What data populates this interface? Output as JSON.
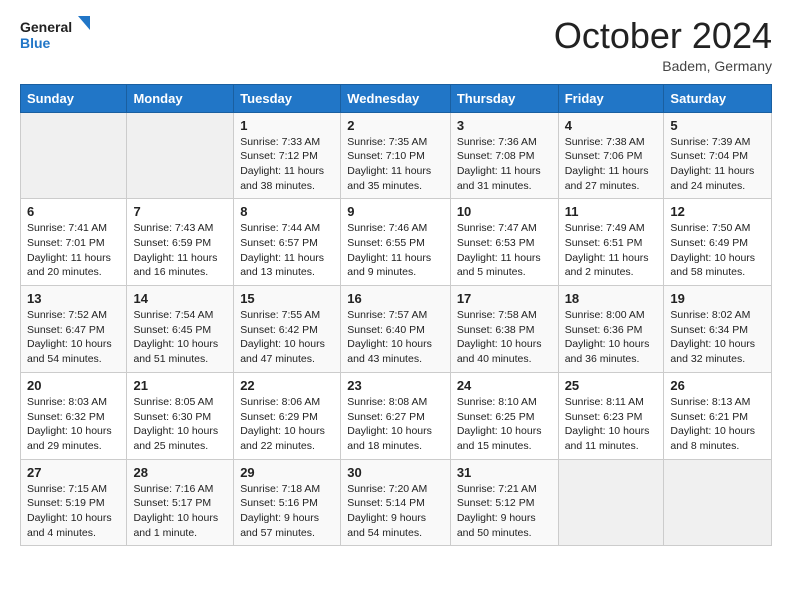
{
  "logo": {
    "line1": "General",
    "line2": "Blue"
  },
  "header": {
    "month": "October 2024",
    "location": "Badem, Germany"
  },
  "weekdays": [
    "Sunday",
    "Monday",
    "Tuesday",
    "Wednesday",
    "Thursday",
    "Friday",
    "Saturday"
  ],
  "weeks": [
    [
      {
        "day": "",
        "info": ""
      },
      {
        "day": "",
        "info": ""
      },
      {
        "day": "1",
        "info": "Sunrise: 7:33 AM\nSunset: 7:12 PM\nDaylight: 11 hours and 38 minutes."
      },
      {
        "day": "2",
        "info": "Sunrise: 7:35 AM\nSunset: 7:10 PM\nDaylight: 11 hours and 35 minutes."
      },
      {
        "day": "3",
        "info": "Sunrise: 7:36 AM\nSunset: 7:08 PM\nDaylight: 11 hours and 31 minutes."
      },
      {
        "day": "4",
        "info": "Sunrise: 7:38 AM\nSunset: 7:06 PM\nDaylight: 11 hours and 27 minutes."
      },
      {
        "day": "5",
        "info": "Sunrise: 7:39 AM\nSunset: 7:04 PM\nDaylight: 11 hours and 24 minutes."
      }
    ],
    [
      {
        "day": "6",
        "info": "Sunrise: 7:41 AM\nSunset: 7:01 PM\nDaylight: 11 hours and 20 minutes."
      },
      {
        "day": "7",
        "info": "Sunrise: 7:43 AM\nSunset: 6:59 PM\nDaylight: 11 hours and 16 minutes."
      },
      {
        "day": "8",
        "info": "Sunrise: 7:44 AM\nSunset: 6:57 PM\nDaylight: 11 hours and 13 minutes."
      },
      {
        "day": "9",
        "info": "Sunrise: 7:46 AM\nSunset: 6:55 PM\nDaylight: 11 hours and 9 minutes."
      },
      {
        "day": "10",
        "info": "Sunrise: 7:47 AM\nSunset: 6:53 PM\nDaylight: 11 hours and 5 minutes."
      },
      {
        "day": "11",
        "info": "Sunrise: 7:49 AM\nSunset: 6:51 PM\nDaylight: 11 hours and 2 minutes."
      },
      {
        "day": "12",
        "info": "Sunrise: 7:50 AM\nSunset: 6:49 PM\nDaylight: 10 hours and 58 minutes."
      }
    ],
    [
      {
        "day": "13",
        "info": "Sunrise: 7:52 AM\nSunset: 6:47 PM\nDaylight: 10 hours and 54 minutes."
      },
      {
        "day": "14",
        "info": "Sunrise: 7:54 AM\nSunset: 6:45 PM\nDaylight: 10 hours and 51 minutes."
      },
      {
        "day": "15",
        "info": "Sunrise: 7:55 AM\nSunset: 6:42 PM\nDaylight: 10 hours and 47 minutes."
      },
      {
        "day": "16",
        "info": "Sunrise: 7:57 AM\nSunset: 6:40 PM\nDaylight: 10 hours and 43 minutes."
      },
      {
        "day": "17",
        "info": "Sunrise: 7:58 AM\nSunset: 6:38 PM\nDaylight: 10 hours and 40 minutes."
      },
      {
        "day": "18",
        "info": "Sunrise: 8:00 AM\nSunset: 6:36 PM\nDaylight: 10 hours and 36 minutes."
      },
      {
        "day": "19",
        "info": "Sunrise: 8:02 AM\nSunset: 6:34 PM\nDaylight: 10 hours and 32 minutes."
      }
    ],
    [
      {
        "day": "20",
        "info": "Sunrise: 8:03 AM\nSunset: 6:32 PM\nDaylight: 10 hours and 29 minutes."
      },
      {
        "day": "21",
        "info": "Sunrise: 8:05 AM\nSunset: 6:30 PM\nDaylight: 10 hours and 25 minutes."
      },
      {
        "day": "22",
        "info": "Sunrise: 8:06 AM\nSunset: 6:29 PM\nDaylight: 10 hours and 22 minutes."
      },
      {
        "day": "23",
        "info": "Sunrise: 8:08 AM\nSunset: 6:27 PM\nDaylight: 10 hours and 18 minutes."
      },
      {
        "day": "24",
        "info": "Sunrise: 8:10 AM\nSunset: 6:25 PM\nDaylight: 10 hours and 15 minutes."
      },
      {
        "day": "25",
        "info": "Sunrise: 8:11 AM\nSunset: 6:23 PM\nDaylight: 10 hours and 11 minutes."
      },
      {
        "day": "26",
        "info": "Sunrise: 8:13 AM\nSunset: 6:21 PM\nDaylight: 10 hours and 8 minutes."
      }
    ],
    [
      {
        "day": "27",
        "info": "Sunrise: 7:15 AM\nSunset: 5:19 PM\nDaylight: 10 hours and 4 minutes."
      },
      {
        "day": "28",
        "info": "Sunrise: 7:16 AM\nSunset: 5:17 PM\nDaylight: 10 hours and 1 minute."
      },
      {
        "day": "29",
        "info": "Sunrise: 7:18 AM\nSunset: 5:16 PM\nDaylight: 9 hours and 57 minutes."
      },
      {
        "day": "30",
        "info": "Sunrise: 7:20 AM\nSunset: 5:14 PM\nDaylight: 9 hours and 54 minutes."
      },
      {
        "day": "31",
        "info": "Sunrise: 7:21 AM\nSunset: 5:12 PM\nDaylight: 9 hours and 50 minutes."
      },
      {
        "day": "",
        "info": ""
      },
      {
        "day": "",
        "info": ""
      }
    ]
  ]
}
